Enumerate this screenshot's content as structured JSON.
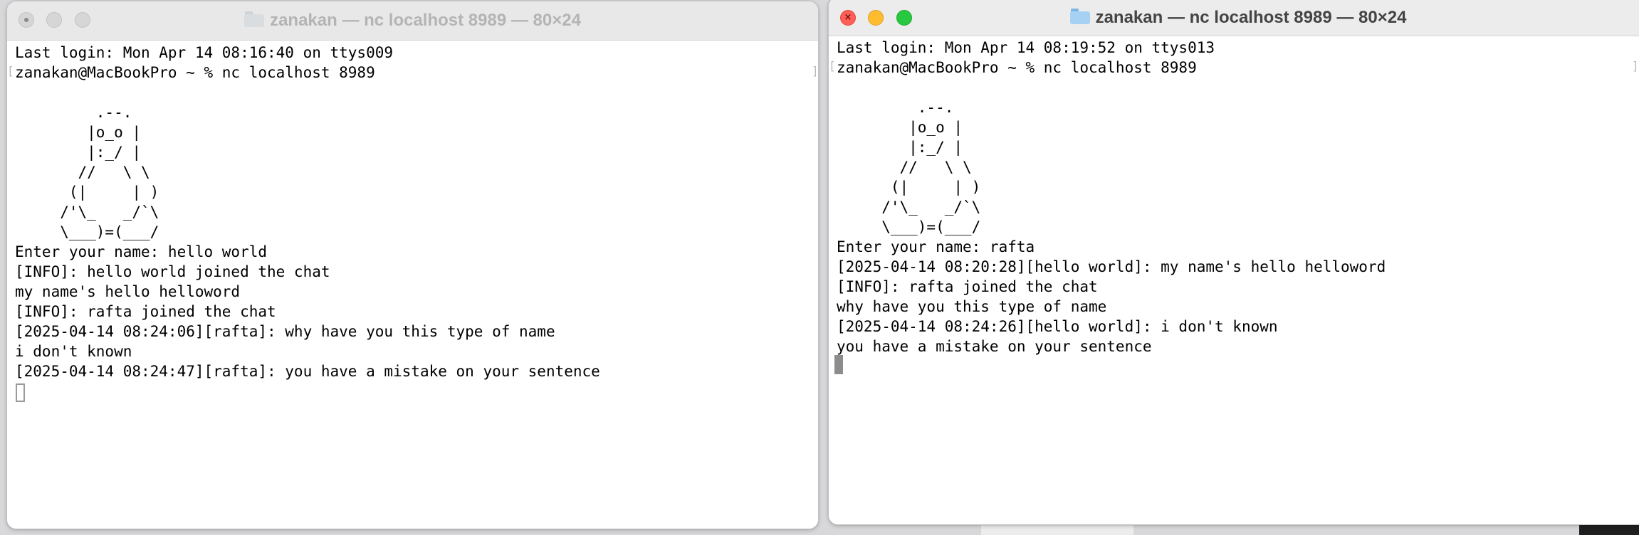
{
  "windows": {
    "left": {
      "title": "zanakan — nc localhost 8989 — 80×24",
      "folder_icon": "folder-icon",
      "lines": [
        "Last login: Mon Apr 14 08:16:40 on ttys009",
        "zanakan@MacBookPro ~ % nc localhost 8989",
        "",
        "         .--.",
        "        |o_o |",
        "        |:_/ |",
        "       //   \\ \\",
        "      (|     | )",
        "     /'\\_   _/`\\",
        "     \\___)=(___/",
        "Enter your name: hello world",
        "[INFO]: hello world joined the chat",
        "my name's hello helloword",
        "[INFO]: rafta joined the chat",
        "[2025-04-14 08:24:06][rafta]: why have you this type of name",
        "i don't known",
        "[2025-04-14 08:24:47][rafta]: you have a mistake on your sentence"
      ]
    },
    "right": {
      "title": "zanakan — nc localhost 8989 — 80×24",
      "folder_icon": "folder-icon",
      "lines": [
        "Last login: Mon Apr 14 08:19:52 on ttys013",
        "zanakan@MacBookPro ~ % nc localhost 8989",
        "",
        "         .--.",
        "        |o_o |",
        "        |:_/ |",
        "       //   \\ \\",
        "      (|     | )",
        "     /'\\_   _/`\\",
        "     \\___)=(___/",
        "Enter your name: rafta",
        "[2025-04-14 08:20:28][hello world]: my name's hello helloword",
        "[INFO]: rafta joined the chat",
        "why have you this type of name",
        "[2025-04-14 08:24:26][hello world]: i don't known",
        "you have a mistake on your sentence"
      ]
    }
  },
  "colors": {
    "close": "#ff5f57",
    "minimize": "#febc2e",
    "maximize": "#28c840",
    "inactive_light": "#d6d6d6"
  }
}
